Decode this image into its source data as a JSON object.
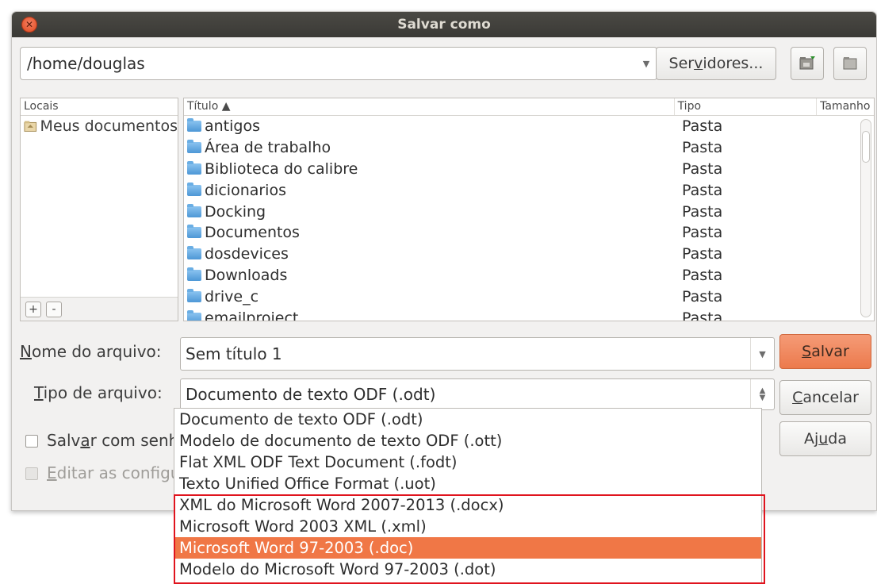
{
  "window": {
    "title": "Salvar como",
    "close_icon": "close-icon"
  },
  "location": {
    "path": "/home/douglas",
    "servers_label_pre": "Ser",
    "servers_label_u": "v",
    "servers_label_post": "idores..."
  },
  "places": {
    "header": "Locais",
    "items": [
      {
        "label": "Meus documentos",
        "icon": "folder-home-icon"
      }
    ],
    "add_label": "+",
    "remove_label": "-"
  },
  "files": {
    "columns": {
      "title": "Título ▲",
      "type": "Tipo",
      "size": "Tamanho"
    },
    "rows": [
      {
        "name": "antigos",
        "type": "Pasta"
      },
      {
        "name": "Área de trabalho",
        "type": "Pasta"
      },
      {
        "name": "Biblioteca do calibre",
        "type": "Pasta"
      },
      {
        "name": "dicionarios",
        "type": "Pasta"
      },
      {
        "name": "Docking",
        "type": "Pasta"
      },
      {
        "name": "Documentos",
        "type": "Pasta"
      },
      {
        "name": "dosdevices",
        "type": "Pasta"
      },
      {
        "name": "Downloads",
        "type": "Pasta"
      },
      {
        "name": "drive_c",
        "type": "Pasta"
      },
      {
        "name": "emailproject",
        "type": "Pasta"
      }
    ]
  },
  "form": {
    "filename_label_u": "N",
    "filename_label_rest": "ome do arquivo:",
    "filename_value": "Sem título 1",
    "filetype_label_u": "T",
    "filetype_label_rest": "ipo de arquivo:",
    "filetype_value": "Documento de texto ODF (.odt)",
    "password_pre": "Salv",
    "password_u": "a",
    "password_post": "r com senha",
    "edit_u": "E",
    "edit_post": "ditar as configurações do filtro"
  },
  "buttons": {
    "save_u": "S",
    "save_rest": "alvar",
    "cancel_u": "C",
    "cancel_rest": "ancelar",
    "help_pre": "Aj",
    "help_u": "u",
    "help_post": "da"
  },
  "filetype_options": [
    "Documento de texto ODF (.odt)",
    "Modelo de documento de texto ODF (.ott)",
    "Flat XML ODF Text Document (.fodt)",
    "Texto Unified Office Format (.uot)",
    "XML do Microsoft Word 2007-2013 (.docx)",
    "Microsoft Word 2003 XML (.xml)",
    "Microsoft Word 97-2003 (.doc)",
    "Modelo do Microsoft Word 97-2003 (.dot)"
  ],
  "selected_option_index": 6,
  "colors": {
    "accent": "#f07746",
    "highlight_border": "#e0141e",
    "titlebar": "#3b3a36"
  }
}
